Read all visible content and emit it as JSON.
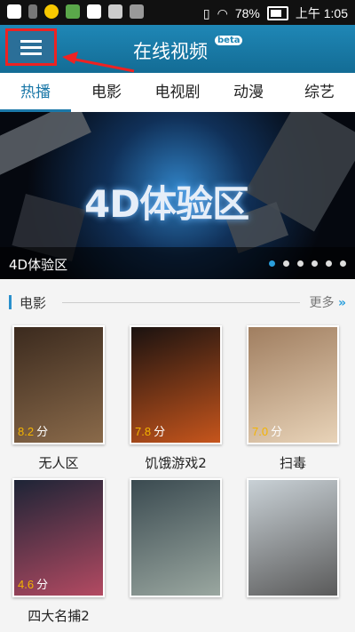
{
  "status_bar": {
    "icons": [
      "back-icon",
      "usb-icon",
      "app-icon",
      "app2-icon",
      "shield-icon",
      "mail-icon",
      "image-icon"
    ],
    "battery": "78%",
    "time": "上午 1:05"
  },
  "app_bar": {
    "title": "在线视频",
    "badge": "beta"
  },
  "tabs": [
    "热播",
    "电影",
    "电视剧",
    "动漫",
    "综艺"
  ],
  "banner": {
    "big_text": "4D体验区",
    "caption": "4D体验区",
    "dots": 6,
    "active_dot": 0
  },
  "section": {
    "title": "电影",
    "more": "更多",
    "movies": [
      {
        "title": "无人区",
        "rating": "8.2",
        "unit": "分",
        "colors": [
          "#3b2a1e",
          "#8a6a4a"
        ]
      },
      {
        "title": "饥饿游戏2",
        "rating": "7.8",
        "unit": "分",
        "colors": [
          "#1a1210",
          "#c6551c"
        ]
      },
      {
        "title": "扫毒",
        "rating": "7.0",
        "unit": "分",
        "colors": [
          "#a07e60",
          "#e8d3b8"
        ]
      },
      {
        "title": "四大名捕2",
        "rating": "4.6",
        "unit": "分",
        "colors": [
          "#1d2436",
          "#b34a62"
        ]
      },
      {
        "title": "",
        "rating": "",
        "unit": "",
        "colors": [
          "#3a4a50",
          "#9aa7a0"
        ]
      },
      {
        "title": "",
        "rating": "",
        "unit": "",
        "colors": [
          "#c9d1d6",
          "#5a5a5a"
        ]
      }
    ]
  }
}
